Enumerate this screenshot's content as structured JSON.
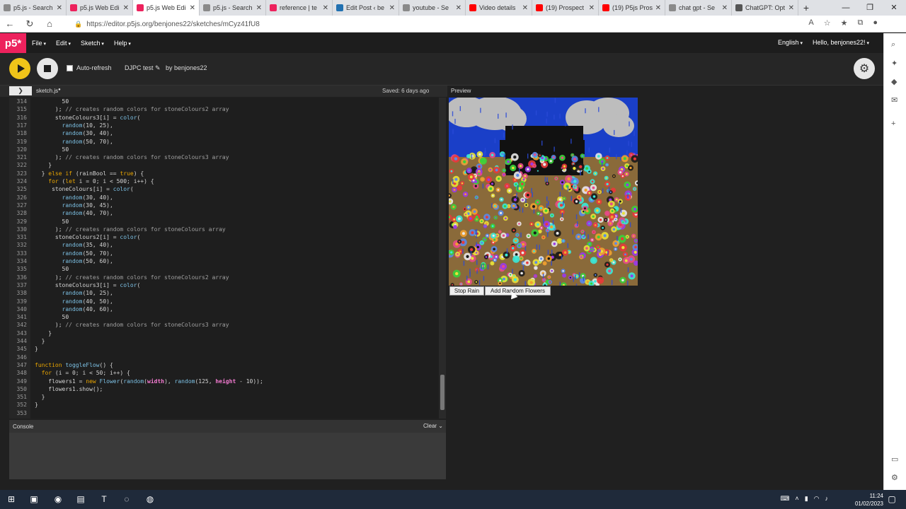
{
  "browser": {
    "tabs": [
      {
        "title": "p5.js - Search",
        "icon_color": "#8a8a8a"
      },
      {
        "title": "p5.js Web Edi",
        "icon_color": "#ed225d"
      },
      {
        "title": "p5.js Web Edi",
        "icon_color": "#ed225d",
        "active": true
      },
      {
        "title": "p5.js - Search",
        "icon_color": "#8a8a8a"
      },
      {
        "title": "reference | te",
        "icon_color": "#ed225d"
      },
      {
        "title": "Edit Post ‹ be",
        "icon_color": "#2271b1"
      },
      {
        "title": "youtube - Se",
        "icon_color": "#8a8a8a"
      },
      {
        "title": "Video details",
        "icon_color": "#ff0000"
      },
      {
        "title": "(19) Prospect",
        "icon_color": "#ff0000"
      },
      {
        "title": "(19) P5js Pros",
        "icon_color": "#ff0000"
      },
      {
        "title": "chat gpt - Se",
        "icon_color": "#8a8a8a"
      },
      {
        "title": "ChatGPT: Opt",
        "icon_color": "#555555"
      }
    ],
    "url": "https://editor.p5js.org/benjones22/sketches/mCyz41fU8"
  },
  "p5nav": {
    "logo": "p5*",
    "menus": [
      "File",
      "Edit",
      "Sketch",
      "Help"
    ],
    "language": "English",
    "user": "Hello, benjones22!"
  },
  "toolbar": {
    "auto_refresh": "Auto-refresh",
    "sketch_name": "DJPC test",
    "byline": "by benjones22"
  },
  "editor": {
    "filename": "sketch.js",
    "saved": "Saved: 6 days ago",
    "preview_label": "Preview",
    "lines": [
      {
        "n": "314",
        "code": "        50"
      },
      {
        "n": "315",
        "code": "      ); // creates random colors for stoneColours2 array"
      },
      {
        "n": "316",
        "code": "      stoneColours3[i] = color("
      },
      {
        "n": "317",
        "code": "        random(10, 25),"
      },
      {
        "n": "318",
        "code": "        random(30, 40),"
      },
      {
        "n": "319",
        "code": "        random(50, 70),"
      },
      {
        "n": "320",
        "code": "        50"
      },
      {
        "n": "321",
        "code": "      ); // creates random colors for stoneColours3 array"
      },
      {
        "n": "322",
        "code": "    }"
      },
      {
        "n": "323",
        "code": "  } else if (rainBool == true) {"
      },
      {
        "n": "324",
        "code": "    for (let i = 0; i < 500; i++) {"
      },
      {
        "n": "325",
        "code": "     stoneColours[i] = color("
      },
      {
        "n": "326",
        "code": "        random(30, 40),"
      },
      {
        "n": "327",
        "code": "        random(30, 45),"
      },
      {
        "n": "328",
        "code": "        random(40, 70),"
      },
      {
        "n": "329",
        "code": "        50"
      },
      {
        "n": "330",
        "code": "      ); // creates random colors for stoneColours array"
      },
      {
        "n": "331",
        "code": "      stoneColours2[i] = color("
      },
      {
        "n": "332",
        "code": "        random(35, 40),"
      },
      {
        "n": "333",
        "code": "        random(50, 70),"
      },
      {
        "n": "334",
        "code": "        random(50, 60),"
      },
      {
        "n": "335",
        "code": "        50"
      },
      {
        "n": "336",
        "code": "      ); // creates random colors for stoneColours2 array"
      },
      {
        "n": "337",
        "code": "      stoneColours3[i] = color("
      },
      {
        "n": "338",
        "code": "        random(10, 25),"
      },
      {
        "n": "339",
        "code": "        random(40, 50),"
      },
      {
        "n": "340",
        "code": "        random(40, 60),"
      },
      {
        "n": "341",
        "code": "        50"
      },
      {
        "n": "342",
        "code": "      ); // creates random colors for stoneColours3 array"
      },
      {
        "n": "343",
        "code": "    }"
      },
      {
        "n": "344",
        "code": "  }"
      },
      {
        "n": "345",
        "code": "}"
      },
      {
        "n": "346",
        "code": ""
      },
      {
        "n": "347",
        "code": "function toggleFlow() {"
      },
      {
        "n": "348",
        "code": "  for (i = 0; i < 50; i++) {"
      },
      {
        "n": "349",
        "code": "    flowers1 = new Flower(random(width), random(125, height - 10));"
      },
      {
        "n": "350",
        "code": "    flowers1.show();"
      },
      {
        "n": "351",
        "code": "  }"
      },
      {
        "n": "352",
        "code": "}"
      },
      {
        "n": "353",
        "code": ""
      }
    ]
  },
  "console": {
    "title": "Console",
    "clear": "Clear"
  },
  "preview": {
    "stop_rain": "Stop Rain",
    "add_flowers": "Add Random Flowers"
  },
  "taskbar": {
    "time": "11:24",
    "date": "01/02/2023"
  },
  "colors": {
    "p5_pink": "#ed225d",
    "play_yellow": "#f0c419",
    "sky": "#1a3fc8",
    "ground": "#8a6a3a"
  }
}
